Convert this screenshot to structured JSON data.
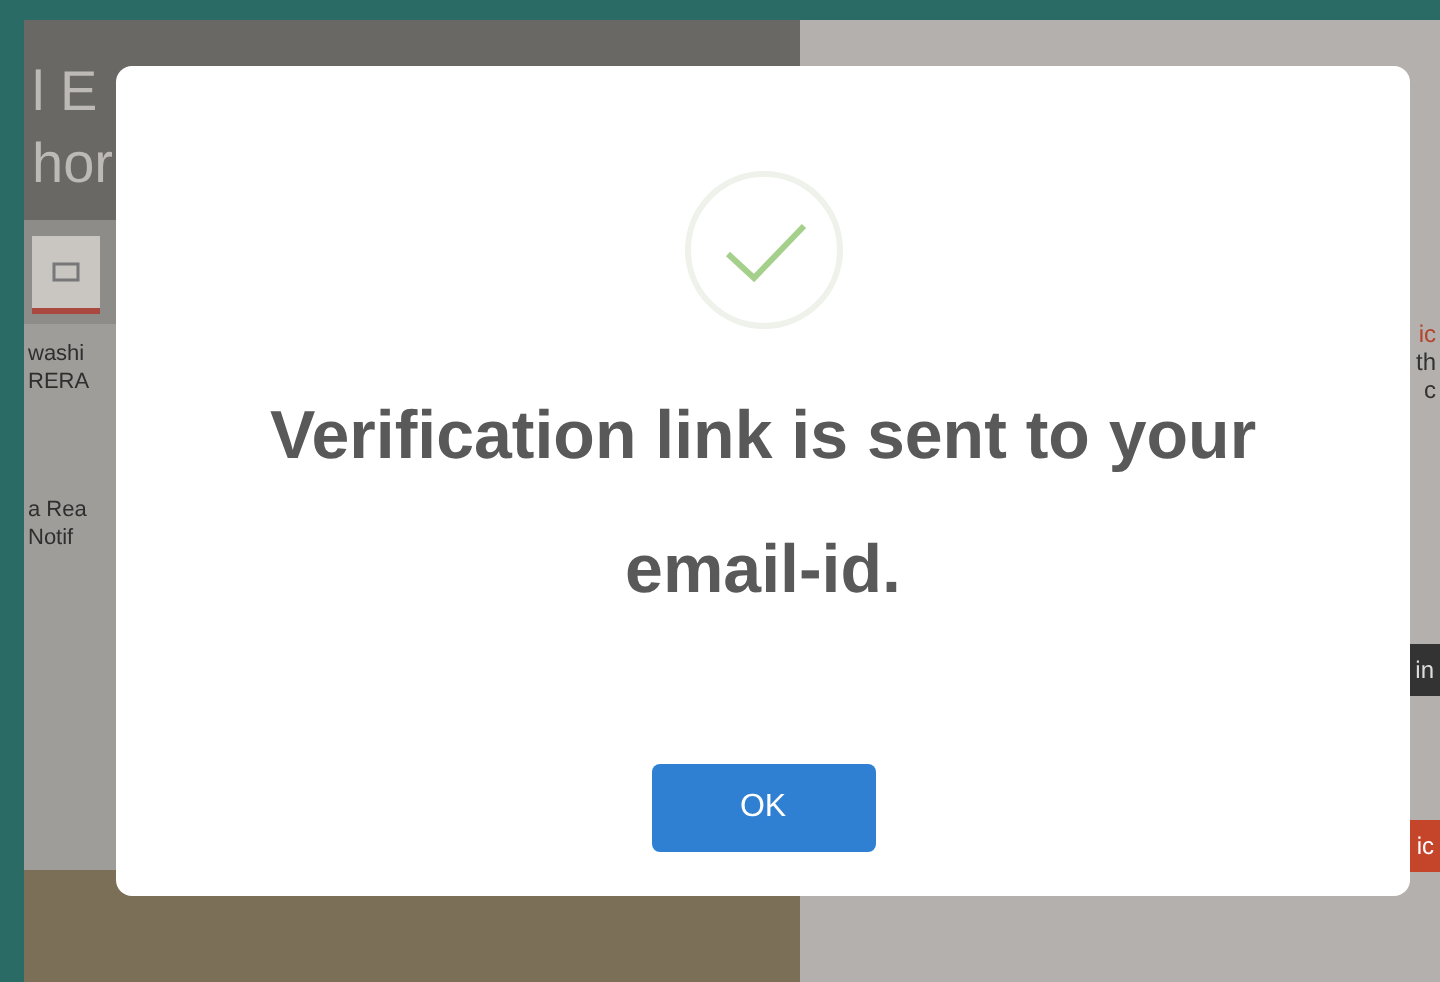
{
  "background_page": {
    "header_lines": [
      "l E",
      "hor"
    ],
    "left_texts": [
      "washi",
      "RERA",
      "a Rea",
      "Notif"
    ],
    "right_texts": [
      {
        "text": "ic",
        "kind": "link"
      },
      {
        "text": "th",
        "kind": "plain"
      },
      {
        "text": "c",
        "kind": "plain"
      },
      {
        "text": "in",
        "kind": "dark-button"
      },
      {
        "text": "ic",
        "kind": "orange-button"
      }
    ]
  },
  "dialog": {
    "message": "Verification link is sent to your email-id.",
    "button": "OK"
  }
}
